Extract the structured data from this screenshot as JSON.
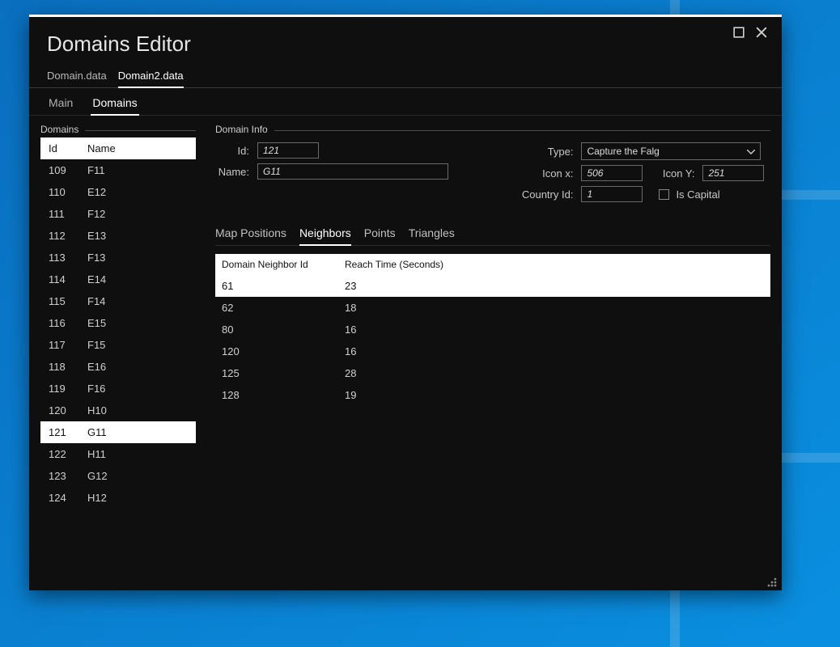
{
  "window": {
    "title": "Domains Editor"
  },
  "file_tabs": {
    "items": [
      "Domain.data",
      "Domain2.data"
    ],
    "active_index": 1
  },
  "nav_tabs": {
    "items": [
      "Main",
      "Domains"
    ],
    "active_index": 1
  },
  "domains_panel": {
    "legend": "Domains",
    "header_id": "Id",
    "header_name": "Name",
    "rows": [
      {
        "id": "109",
        "name": "F11"
      },
      {
        "id": "110",
        "name": "E12"
      },
      {
        "id": "111",
        "name": "F12"
      },
      {
        "id": "112",
        "name": "E13"
      },
      {
        "id": "113",
        "name": "F13"
      },
      {
        "id": "114",
        "name": "E14"
      },
      {
        "id": "115",
        "name": "F14"
      },
      {
        "id": "116",
        "name": "E15"
      },
      {
        "id": "117",
        "name": "F15"
      },
      {
        "id": "118",
        "name": "E16"
      },
      {
        "id": "119",
        "name": "F16"
      },
      {
        "id": "120",
        "name": "H10"
      },
      {
        "id": "121",
        "name": "G11"
      },
      {
        "id": "122",
        "name": "H11"
      },
      {
        "id": "123",
        "name": "G12"
      },
      {
        "id": "124",
        "name": "H12"
      }
    ],
    "selected_id": "121"
  },
  "info_panel": {
    "legend": "Domain Info",
    "labels": {
      "id": "Id:",
      "name": "Name:",
      "type": "Type:",
      "icon_x": "Icon x:",
      "icon_y": "Icon Y:",
      "country_id": "Country Id:",
      "is_capital": "Is Capital"
    },
    "values": {
      "id": "121",
      "name": "G11",
      "type": "Capture the Falg",
      "icon_x": "506",
      "icon_y": "251",
      "country_id": "1",
      "is_capital": false
    }
  },
  "sub_tabs": {
    "items": [
      "Map Positions",
      "Neighbors",
      "Points",
      "Triangles"
    ],
    "active_index": 1
  },
  "neighbors": {
    "header_id": "Domain Neighbor Id",
    "header_time": "Reach Time (Seconds)",
    "rows": [
      {
        "id": "61",
        "time": "23"
      },
      {
        "id": "62",
        "time": "18"
      },
      {
        "id": "80",
        "time": "16"
      },
      {
        "id": "120",
        "time": "16"
      },
      {
        "id": "125",
        "time": "28"
      },
      {
        "id": "128",
        "time": "19"
      }
    ],
    "selected_id": "61"
  }
}
